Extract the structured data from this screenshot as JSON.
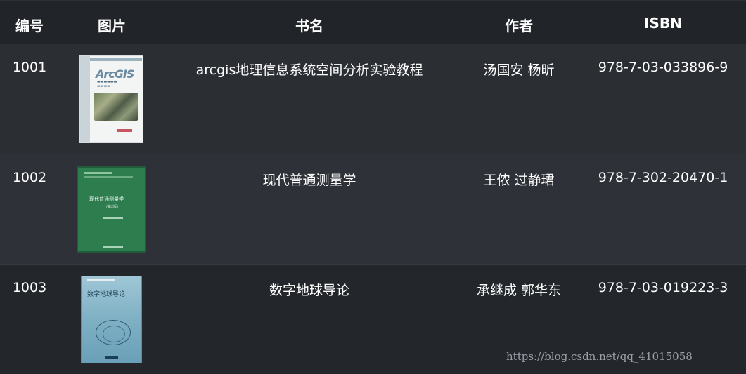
{
  "headers": {
    "id": "编号",
    "image": "图片",
    "title": "书名",
    "author": "作者",
    "isbn": "ISBN"
  },
  "rows": [
    {
      "id": "1001",
      "title": "arcgis地理信息系统空间分析实验教程",
      "author": "汤国安 杨昕",
      "isbn": "978-7-03-033896-9",
      "cover": {
        "logo": "ArcGIS",
        "accent": "#6b8aa1"
      }
    },
    {
      "id": "1002",
      "title": "现代普通测量学",
      "author": "王侬 过静珺",
      "isbn": "978-7-302-20470-1",
      "cover": {
        "title": "现代普通测量学",
        "edition": "(第2版)",
        "accent": "#2e7d4f"
      }
    },
    {
      "id": "1003",
      "title": "数字地球导论",
      "author": "承继成 郭华东",
      "isbn": "978-7-03-019223-3",
      "cover": {
        "title": "数字地球导论",
        "accent": "#7fb0c4"
      }
    }
  ],
  "watermark": "https://blog.csdn.net/qq_41015058"
}
